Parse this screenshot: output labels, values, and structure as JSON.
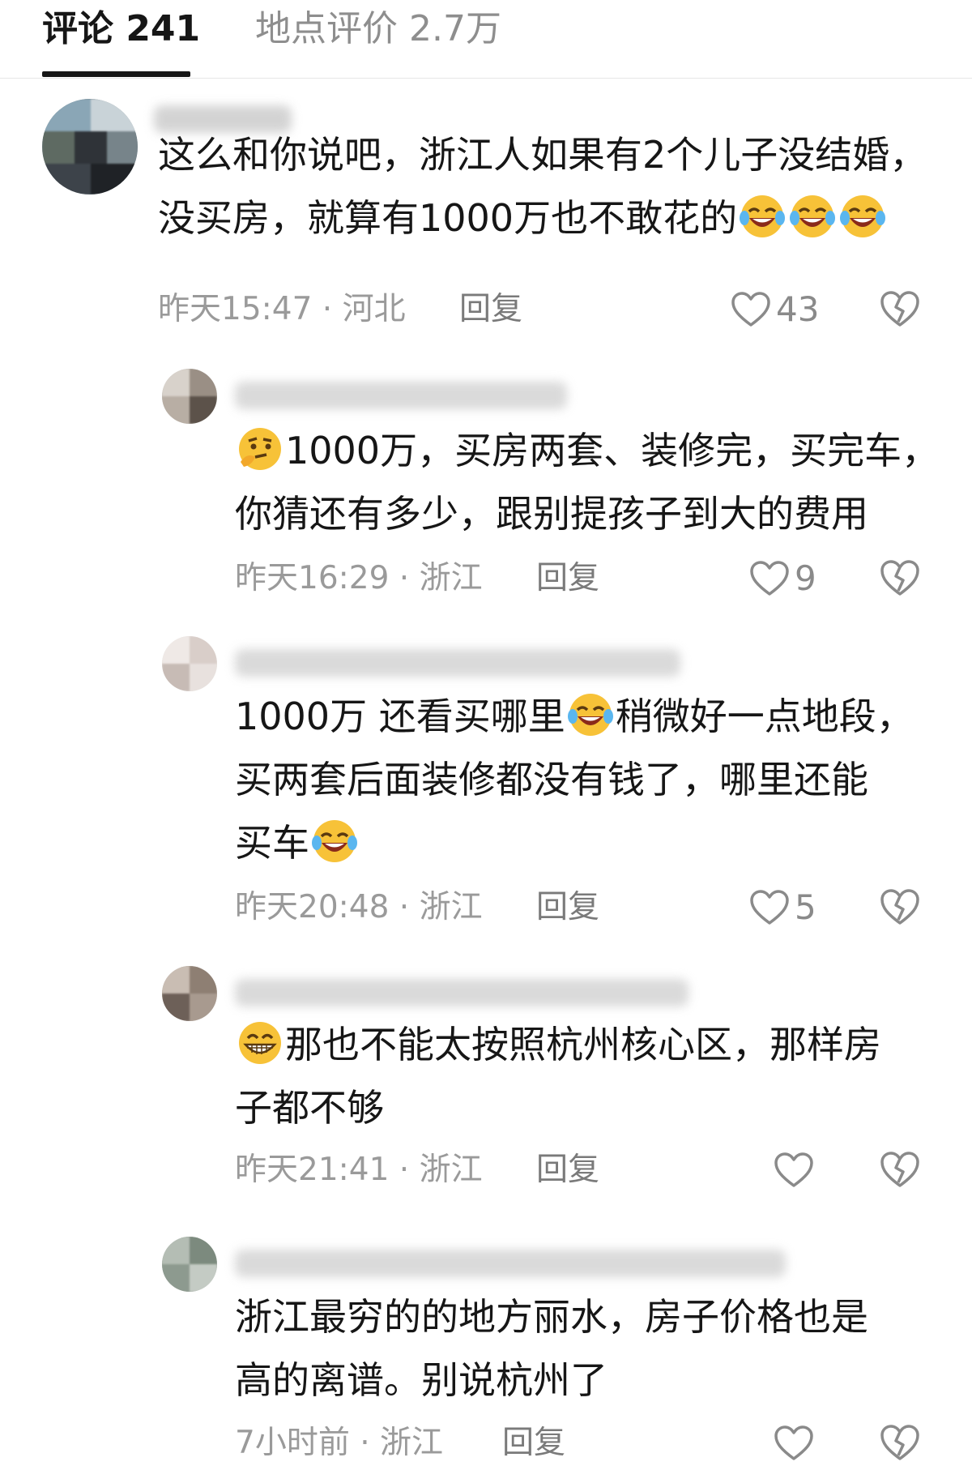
{
  "tabs": {
    "comments_label": "评论 241",
    "reviews_label": "地点评价 2.7万"
  },
  "comments": [
    {
      "lines": [
        "这么和你说吧，浙江人如果有2个儿子没结婚，",
        "没买房，就算有1000万也不敢花的"
      ],
      "time": "昨天15:47",
      "location": "河北",
      "reply_label": "回复",
      "likes": "43"
    },
    {
      "lines": [
        "1000万，买房两套、装修完，买完车，",
        "你猜还有多少，跟别提孩子到大的费用"
      ],
      "time": "昨天16:29",
      "location": "浙江",
      "reply_label": "回复",
      "likes": "9"
    },
    {
      "lines": [
        "1000万 还看买哪里",
        "稍微好一点地段，",
        "买两套后面装修都没有钱了，哪里还能",
        "买车"
      ],
      "time": "昨天20:48",
      "location": "浙江",
      "reply_label": "回复",
      "likes": "5"
    },
    {
      "lines": [
        "那也不能太按照杭州核心区，那样房",
        "子都不够"
      ],
      "time": "昨天21:41",
      "location": "浙江",
      "reply_label": "回复",
      "likes": ""
    },
    {
      "lines": [
        "浙江最穷的的地方丽水，房子价格也是",
        "高的离谱。别说杭州了"
      ],
      "time": "7小时前",
      "location": "浙江",
      "reply_label": "回复",
      "likes": ""
    }
  ],
  "icons": {
    "like": "heart-outline-icon",
    "dislike": "broken-heart-outline-icon",
    "emoji_laugh": "laughing-crying-emoji",
    "emoji_think": "thinking-emoji",
    "emoji_grin": "grinning-emoji"
  },
  "colors": {
    "text": "#161616",
    "meta": "#9a9a9a",
    "divider": "#e6e6e6"
  }
}
